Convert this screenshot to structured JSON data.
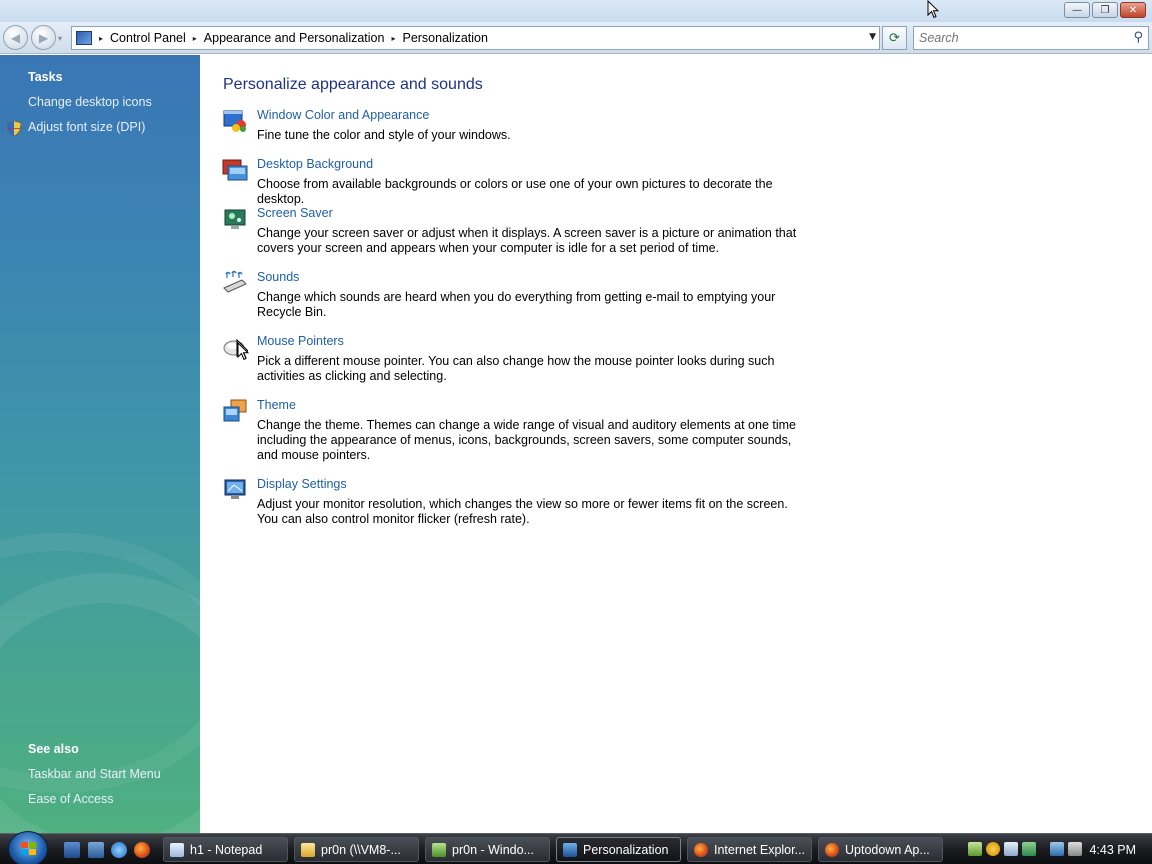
{
  "window": {
    "caption_buttons": {
      "minimize": "—",
      "restore": "❐",
      "close": "✕"
    }
  },
  "navigation": {
    "back_glyph": "◀",
    "forward_glyph": "▶",
    "recent_glyph": "▾",
    "breadcrumbs": [
      "Control Panel",
      "Appearance and Personalization",
      "Personalization"
    ],
    "crumb_separator": "▸",
    "dropdown_glyph": "▼",
    "refresh_glyph": "⟳",
    "search_placeholder": "Search",
    "search_glyph": "⚲"
  },
  "sidebar": {
    "tasks_heading": "Tasks",
    "tasks": [
      {
        "label": "Change desktop icons",
        "icon": null
      },
      {
        "label": "Adjust font size (DPI)",
        "icon": "uac-shield-icon"
      }
    ],
    "see_also_heading": "See also",
    "see_also": [
      {
        "label": "Taskbar and Start Menu"
      },
      {
        "label": "Ease of Access"
      }
    ]
  },
  "main": {
    "title": "Personalize appearance and sounds",
    "items": [
      {
        "link": "Window Color and Appearance",
        "description": "Fine tune the color and style of your windows.",
        "icon": "window-color-icon"
      },
      {
        "link": "Desktop Background",
        "description": "Choose from available backgrounds or colors or use one of your own pictures to decorate the desktop.",
        "icon": "desktop-background-icon"
      },
      {
        "link": "Screen Saver",
        "description": "Change your screen saver or adjust when it displays. A screen saver is a picture or animation that covers your screen and appears when your computer is idle for a set period of time.",
        "icon": "screen-saver-icon"
      },
      {
        "link": "Sounds",
        "description": "Change which sounds are heard when you do everything from getting e-mail to emptying your Recycle Bin.",
        "icon": "sounds-icon"
      },
      {
        "link": "Mouse Pointers",
        "description": "Pick a different mouse pointer. You can also change how the mouse pointer looks during such activities as clicking and selecting.",
        "icon": "mouse-pointers-icon"
      },
      {
        "link": "Theme",
        "description": "Change the theme. Themes can change a wide range of visual and auditory elements at one time including the appearance of menus, icons, backgrounds, screen savers, some computer sounds, and mouse pointers.",
        "icon": "theme-icon"
      },
      {
        "link": "Display Settings",
        "description": "Adjust your monitor resolution, which changes the view so more or fewer items fit on the screen. You can also control monitor flicker (refresh rate).",
        "icon": "display-settings-icon"
      }
    ]
  },
  "taskbar": {
    "tasks": [
      {
        "label": "h1 - Notepad",
        "icon": "notepad-icon",
        "active": false
      },
      {
        "label": "pr0n (\\\\VM8-...",
        "icon": "folder-icon",
        "active": false
      },
      {
        "label": "pr0n - Windo...",
        "icon": "explorer-window-icon",
        "active": false
      },
      {
        "label": "Personalization",
        "icon": "control-panel-icon",
        "active": true
      },
      {
        "label": "Internet Explor...",
        "icon": "firefox-icon",
        "active": false
      },
      {
        "label": "Uptodown Ap...",
        "icon": "firefox-icon",
        "active": false
      }
    ],
    "clock": "4:43 PM"
  },
  "colors": {
    "link": "#1f5fa6",
    "title": "#1e3287",
    "sidebar_top": "#3a76b5",
    "sidebar_bottom": "#4fb080"
  }
}
